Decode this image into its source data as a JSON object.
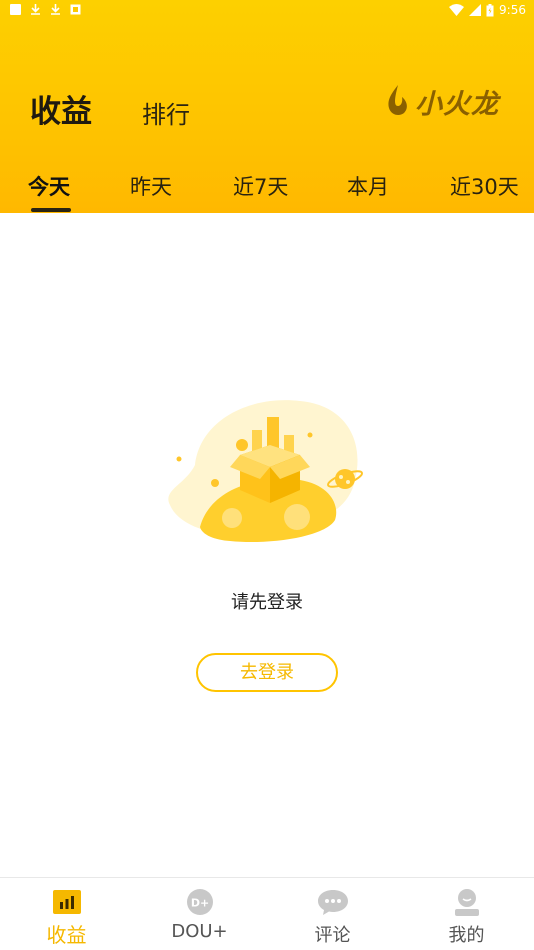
{
  "status_bar": {
    "time": "9:56"
  },
  "header": {
    "tabs": [
      {
        "label": "收益",
        "active": true
      },
      {
        "label": "排行",
        "active": false
      }
    ],
    "logo_text": "小火龙",
    "periods": [
      "今天",
      "昨天",
      "近7天",
      "本月",
      "近30天"
    ],
    "active_period_index": 0
  },
  "main": {
    "prompt": "请先登录",
    "login_button": "去登录"
  },
  "bottom_nav": {
    "items": [
      {
        "label": "收益",
        "icon": "bar-chart-icon",
        "active": true
      },
      {
        "label": "DOU+",
        "icon": "dou-plus-icon",
        "active": false
      },
      {
        "label": "评论",
        "icon": "comment-icon",
        "active": false
      },
      {
        "label": "我的",
        "icon": "profile-icon",
        "active": false
      }
    ]
  },
  "colors": {
    "header_yellow": "#fec300",
    "accent": "#f5b800",
    "inactive_nav": "#c8c8c8"
  }
}
